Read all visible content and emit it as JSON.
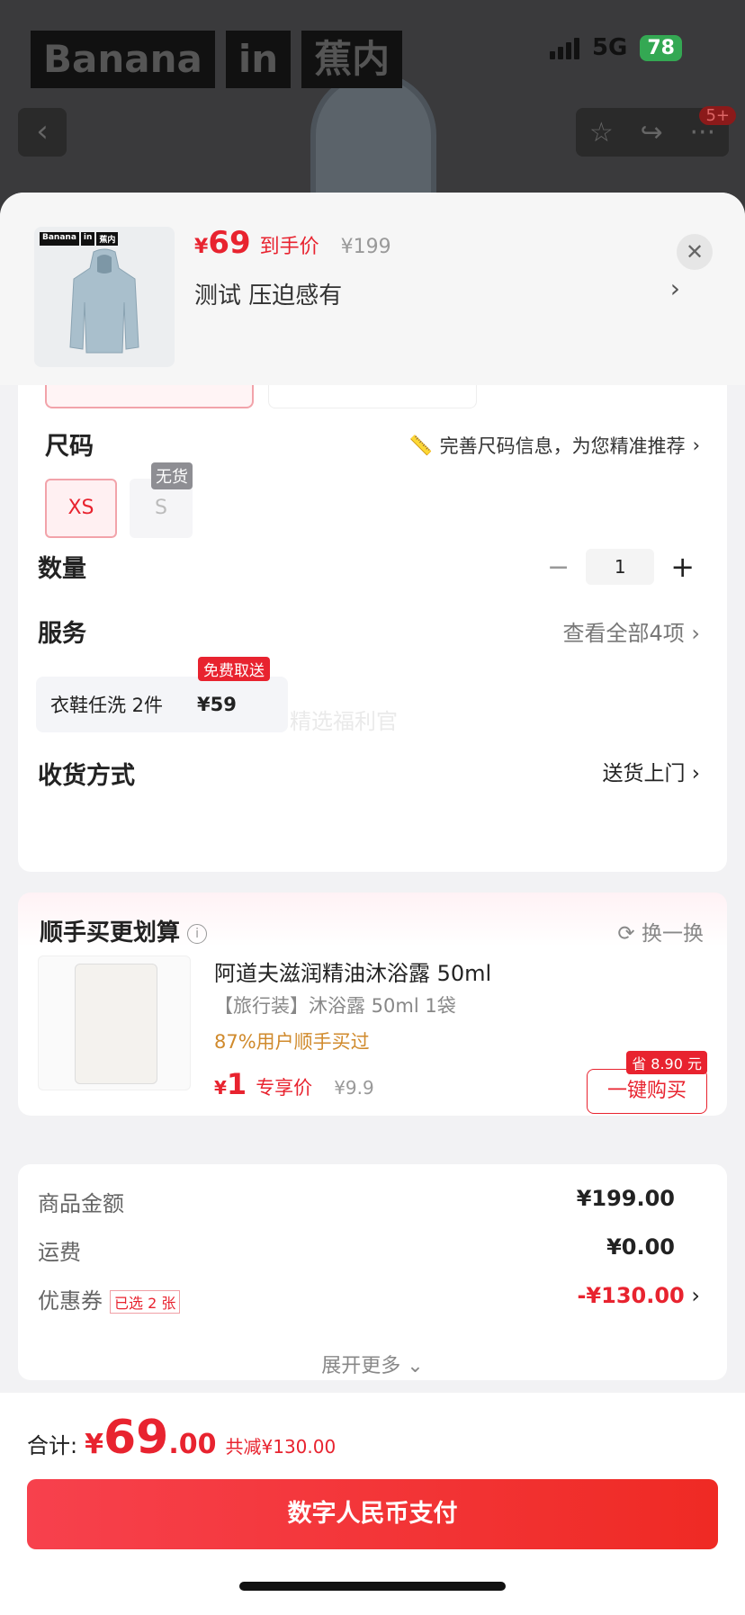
{
  "status_bar": {
    "network": "5G",
    "battery": "78"
  },
  "background": {
    "brand": [
      "Banana",
      "in",
      "蕉内"
    ],
    "notification_count": "5+"
  },
  "product": {
    "price_symbol": "¥",
    "price": "69",
    "price_tag": "到手价",
    "original_price": "¥199",
    "spec": "测试  压迫感有",
    "thumb_logo": [
      "Banana",
      "in",
      "蕉内"
    ]
  },
  "size": {
    "title": "尺码",
    "guide_text": "完善尺码信息，为您精准推荐",
    "options": [
      {
        "label": "XS",
        "selected": true
      },
      {
        "label": "S",
        "badge": "无货"
      }
    ]
  },
  "quantity": {
    "title": "数量",
    "value": "1",
    "minus": "−",
    "plus": "+"
  },
  "service": {
    "title": "服务",
    "view_all": "查看全部4项",
    "item_name": "衣鞋任洗 2件",
    "item_price": "¥59",
    "item_badge": "免费取送",
    "watermark": "精选福利官"
  },
  "delivery": {
    "title": "收货方式",
    "value": "送货上门"
  },
  "addon": {
    "title": "顺手买更划算",
    "refresh": "换一换",
    "name": "阿道夫滋润精油沐浴露 50ml",
    "sub": "【旅行装】沐浴露 50ml 1袋",
    "stat": "87%用户顺手买过",
    "price_symbol": "¥",
    "price": "1",
    "price_tag": "专享价",
    "original_price": "¥9.9",
    "buy_label": "一键购买",
    "save_badge": "省 8.90 元"
  },
  "summary": {
    "rows": [
      {
        "label": "商品金额",
        "amount": "¥199.00"
      },
      {
        "label": "运费",
        "amount": "¥0.00"
      },
      {
        "label": "优惠券",
        "amount": "-¥130.00",
        "tag": "已选 2 张"
      }
    ],
    "expand": "展开更多"
  },
  "footer": {
    "total_label": "合计:",
    "currency": "¥",
    "total_int": "69",
    "total_dec": ".00",
    "saved": "共减¥130.00",
    "pay_label": "数字人民币支付"
  },
  "colors": {
    "accent": "#e8232f",
    "highlight": "#d08a2c"
  }
}
